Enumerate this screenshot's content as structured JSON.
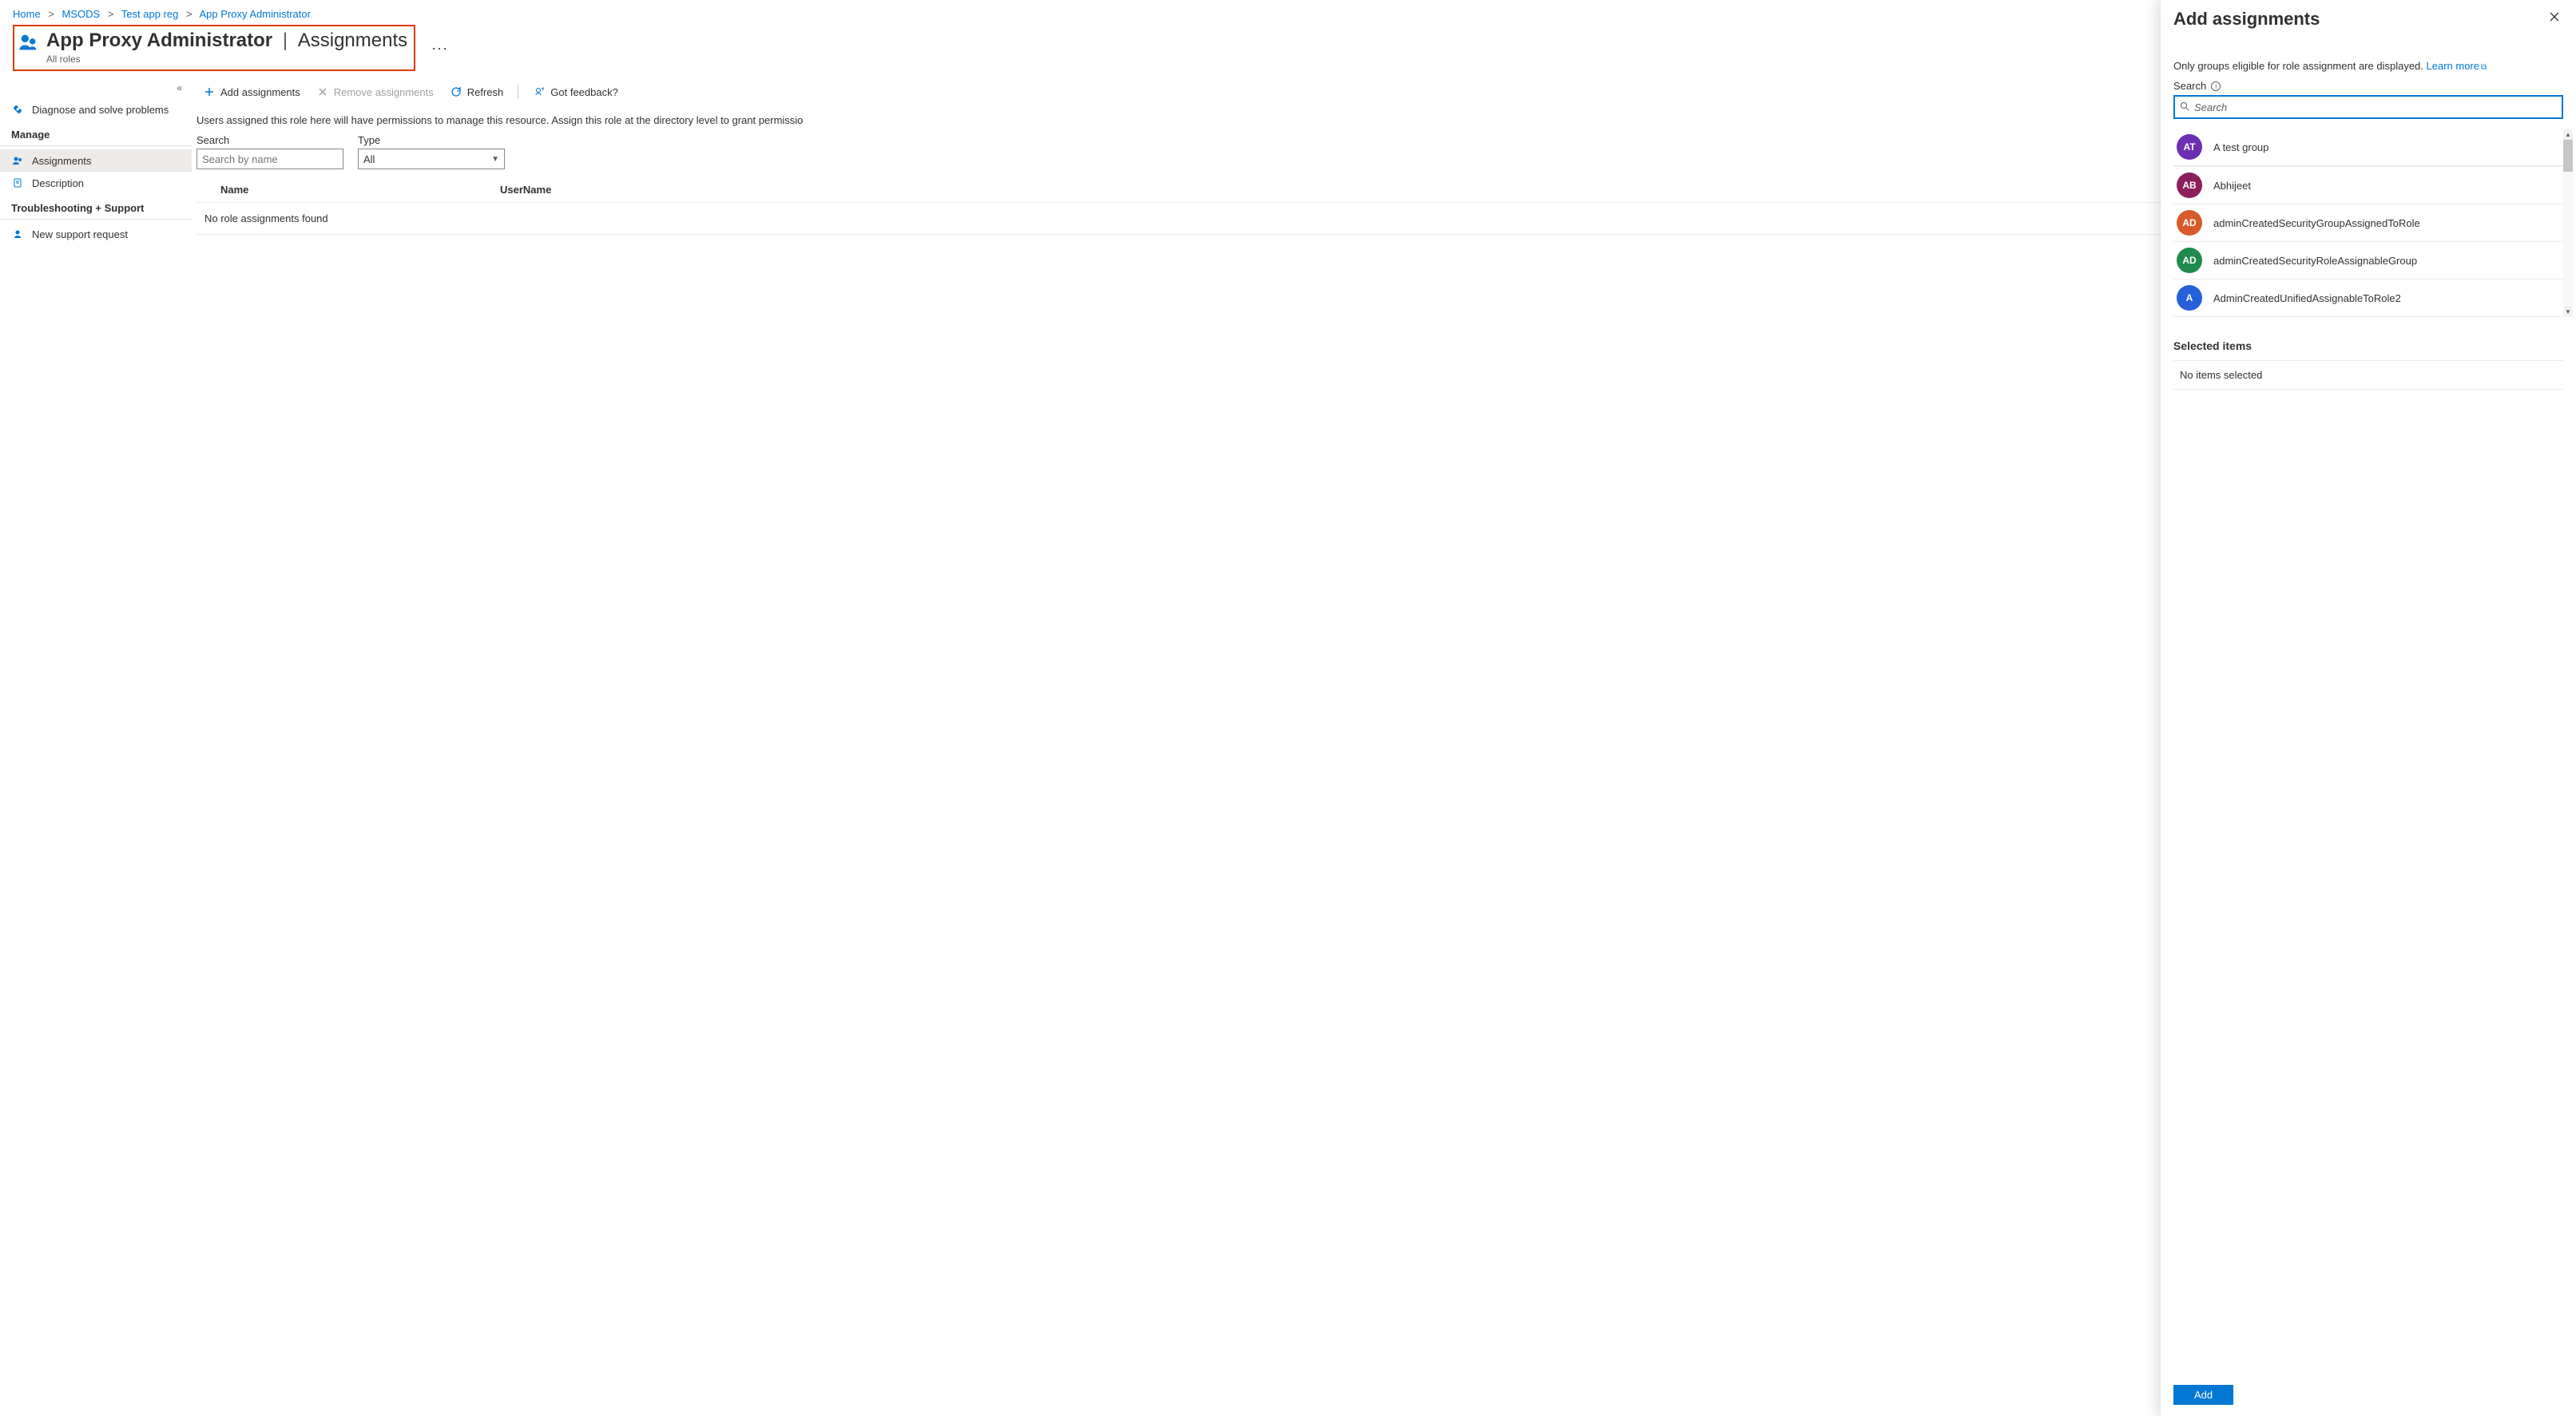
{
  "breadcrumb": {
    "items": [
      "Home",
      "MSODS",
      "Test app reg",
      "App Proxy Administrator"
    ]
  },
  "header": {
    "role_name": "App Proxy Administrator",
    "section": "Assignments",
    "subtitle": "All roles"
  },
  "sidebar": {
    "diagnose": "Diagnose and solve problems",
    "manage_label": "Manage",
    "assignments": "Assignments",
    "description": "Description",
    "troubleshoot_label": "Troubleshooting + Support",
    "support": "New support request"
  },
  "toolbar": {
    "add": "Add assignments",
    "remove": "Remove assignments",
    "refresh": "Refresh",
    "feedback": "Got feedback?"
  },
  "content": {
    "hint": "Users assigned this role here will have permissions to manage this resource. Assign this role at the directory level to grant permissio",
    "search_label": "Search",
    "search_placeholder": "Search by name",
    "type_label": "Type",
    "type_value": "All",
    "col_name": "Name",
    "col_username": "UserName",
    "empty": "No role assignments found"
  },
  "panel": {
    "title": "Add assignments",
    "info_text": "Only groups eligible for role assignment are displayed.",
    "learn_more": "Learn more",
    "search_label": "Search",
    "search_placeholder": "Search",
    "groups": [
      {
        "initials": "AT",
        "color": "#6b2fb3",
        "name": "A test group"
      },
      {
        "initials": "AB",
        "color": "#8a1f5c",
        "name": "Abhijeet"
      },
      {
        "initials": "AD",
        "color": "#d85a2b",
        "name": "adminCreatedSecurityGroupAssignedToRole"
      },
      {
        "initials": "AD",
        "color": "#1f8a4c",
        "name": "adminCreatedSecurityRoleAssignableGroup"
      },
      {
        "initials": "A",
        "color": "#2560d8",
        "name": "AdminCreatedUnifiedAssignableToRole2"
      }
    ],
    "selected_label": "Selected items",
    "selected_empty": "No items selected",
    "add_button": "Add"
  }
}
